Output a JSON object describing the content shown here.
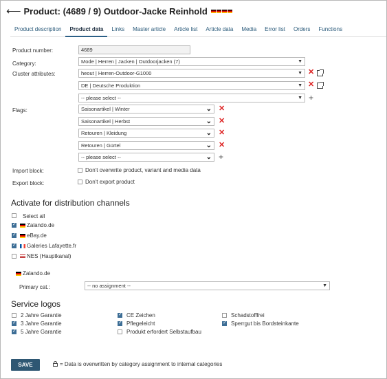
{
  "header": {
    "title": "Product: (4689 / 9) Outdoor-Jacke Reinhold"
  },
  "tabs": [
    "Product description",
    "Product data",
    "Links",
    "Master article",
    "Article list",
    "Article data",
    "Media",
    "Error list",
    "Orders",
    "Functions"
  ],
  "active_tab": "Product data",
  "fields": {
    "product_number": {
      "label": "Product number:",
      "value": "4689"
    },
    "category": {
      "label": "Category:",
      "value": "Mode | Herren | Jacken | Outdoorjacken (7)"
    },
    "cluster": {
      "label": "Cluster attributes:",
      "values": [
        "heout | Herren-Outdoor-G1000",
        "DE | Deutsche Produktion"
      ],
      "placeholder": "-- please select --"
    },
    "flags": {
      "label": "Flags:",
      "values": [
        "Saisonartikel | Winter",
        "Saisonartikel | Herbst",
        "Retouren | Kleidung",
        "Retouren | Gürtel"
      ],
      "placeholder": "-- please select --"
    },
    "import_block": {
      "label": "Import block:",
      "option": "Don't overwrite product, variant and media data",
      "checked": false
    },
    "export_block": {
      "label": "Export block:",
      "option": "Don't export product",
      "checked": false
    }
  },
  "distribution": {
    "title": "Activate for distribution channels",
    "select_all": "Select all",
    "channels": [
      {
        "name": "Zalando.de",
        "checked": true,
        "flag": "de"
      },
      {
        "name": "eBay.de",
        "checked": true,
        "flag": "de"
      },
      {
        "name": "Galeries Lafayette.fr",
        "checked": true,
        "flag": "fr"
      },
      {
        "name": "NES (Hauptkanal)",
        "checked": false,
        "flag": "us"
      }
    ],
    "subsection": {
      "name": "Zalando.de",
      "primary_label": "Primary cat.:",
      "primary_value": "-- no assignment --"
    }
  },
  "service_logos": {
    "title": "Service logos",
    "columns": [
      [
        {
          "label": "2 Jahre Garantie",
          "checked": false
        },
        {
          "label": "3 Jahre Garantie",
          "checked": true
        },
        {
          "label": "5 Jahre Garantie",
          "checked": true
        }
      ],
      [
        {
          "label": "CE Zeichen",
          "checked": true
        },
        {
          "label": "Pflegeleicht",
          "checked": true
        },
        {
          "label": "Produkt erfordert Selbstaufbau",
          "checked": false
        }
      ],
      [
        {
          "label": "Schadstofffrei",
          "checked": false
        },
        {
          "label": "Sperrgut bis Bordsteinkante",
          "checked": true
        }
      ]
    ]
  },
  "footer": {
    "save_label": "SAVE",
    "note": "= Data is overwritten by category assignment to internal categories"
  },
  "colors": {
    "accent": "#2e5773",
    "remove": "#dd2222"
  }
}
